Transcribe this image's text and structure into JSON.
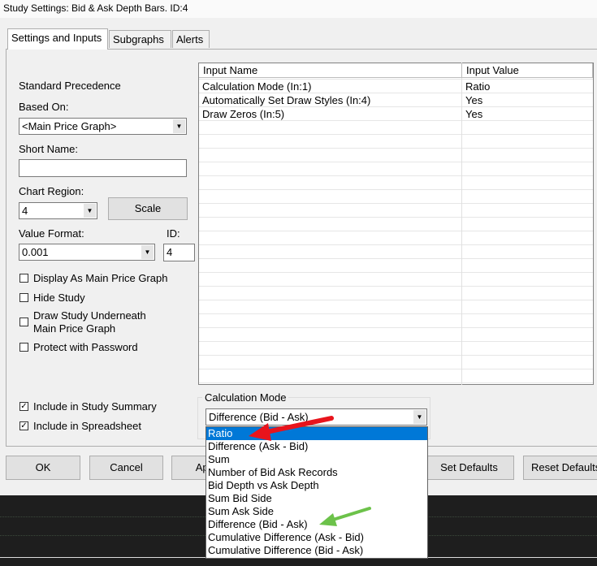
{
  "window": {
    "title": "Study Settings: Bid & Ask Depth Bars. ID:4"
  },
  "tabs": [
    "Settings and Inputs",
    "Subgraphs",
    "Alerts"
  ],
  "left": {
    "standard_precedence": "Standard Precedence",
    "based_on_label": "Based On:",
    "based_on_value": "<Main Price Graph>",
    "short_name_label": "Short Name:",
    "short_name_value": "",
    "chart_region_label": "Chart Region:",
    "chart_region_value": "4",
    "scale_button": "Scale",
    "value_format_label": "Value Format:",
    "value_format_value": "0.001",
    "id_label": "ID:",
    "id_value": "4",
    "checkboxes": [
      {
        "label": "Display As Main Price Graph",
        "checked": false
      },
      {
        "label": "Hide Study",
        "checked": false
      },
      {
        "label": "Draw Study Underneath",
        "label2": "Main Price Graph",
        "checked": false
      },
      {
        "label": "Protect with Password",
        "checked": false
      },
      {
        "label": "Include in Study Summary",
        "checked": true
      },
      {
        "label": "Include in Spreadsheet",
        "checked": true
      }
    ]
  },
  "inputs_table": {
    "headers": [
      "Input Name",
      "Input Value"
    ],
    "rows": [
      {
        "name": "Calculation Mode  (In:1)",
        "value": "Ratio"
      },
      {
        "name": "Automatically Set Draw Styles  (In:4)",
        "value": "Yes"
      },
      {
        "name": "Draw Zeros  (In:5)",
        "value": "Yes"
      }
    ]
  },
  "calc_mode": {
    "group_label": "Calculation Mode",
    "selected": "Difference (Bid - Ask)",
    "options": [
      "Ratio",
      "Difference (Ask - Bid)",
      "Sum",
      "Number of Bid Ask Records",
      "Bid Depth vs Ask Depth",
      "Sum Bid Side",
      "Sum Ask Side",
      "Difference (Bid - Ask)",
      "Cumulative Difference (Ask - Bid)",
      "Cumulative Difference (Bid - Ask)"
    ],
    "highlighted_index": 0
  },
  "buttons": {
    "ok": "OK",
    "cancel": "Cancel",
    "apply": "Apply",
    "set_defaults": "Set Defaults",
    "reset_defaults": "Reset Defaults"
  },
  "colors": {
    "selection": "#0078d7",
    "red_arrow": "#e8141c",
    "green_arrow": "#6cc24a"
  }
}
